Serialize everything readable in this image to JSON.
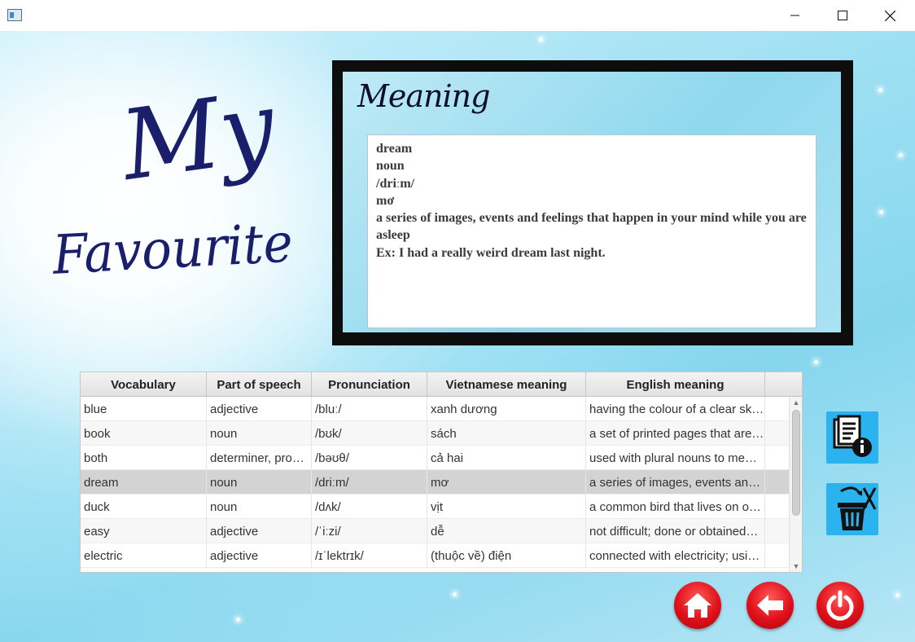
{
  "window": {
    "app_icon": "window-app-icon",
    "controls": [
      "minimize-icon",
      "maximize-icon",
      "close-icon"
    ]
  },
  "title": {
    "line1": "My",
    "line2": "Favourite"
  },
  "meaning": {
    "heading": "Meaning",
    "lines": [
      "dream",
      "noun",
      "/driːm/",
      "mơ",
      "a series of images, events and feelings that happen in your mind while you are asleep",
      "Ex: I had a really weird dream last night."
    ]
  },
  "table": {
    "columns": [
      "Vocabulary",
      "Part of speech",
      "Pronunciation",
      "Vietnamese meaning",
      "English meaning"
    ],
    "rows": [
      [
        "blue",
        "adjective",
        "/bluː/",
        "xanh dương",
        "having the colour of a clear sk…"
      ],
      [
        "book",
        "noun",
        "/bʊk/",
        "sách",
        "a set of printed pages that are…"
      ],
      [
        "both",
        "determiner, pro…",
        "/bəʊθ/",
        "cả hai",
        "used with plural nouns to me…"
      ],
      [
        "dream",
        "noun",
        "/driːm/",
        "mơ",
        "a series of images, events and…"
      ],
      [
        "duck",
        "noun",
        "/dʌk/",
        "vịt",
        "a common bird that lives on o…"
      ],
      [
        "easy",
        "adjective",
        "/ˈiːzi/",
        "dễ",
        "not difficult; done or obtained…"
      ],
      [
        "electric",
        "adjective",
        "/ɪˈlektrɪk/",
        "(thuộc về) điện",
        "connected with electricity; usi…"
      ]
    ],
    "selected_index": 3
  },
  "side_buttons": {
    "info": "document-info-icon",
    "delete": "trash-delete-icon"
  },
  "nav_buttons": {
    "home": "home-icon",
    "back": "back-arrow-icon",
    "power": "power-icon"
  },
  "colors": {
    "accent_blue": "#2ab3ee",
    "button_red": "#e0101a",
    "selected_row": "#d3d3d3",
    "title_ink": "#1a1f6b"
  }
}
